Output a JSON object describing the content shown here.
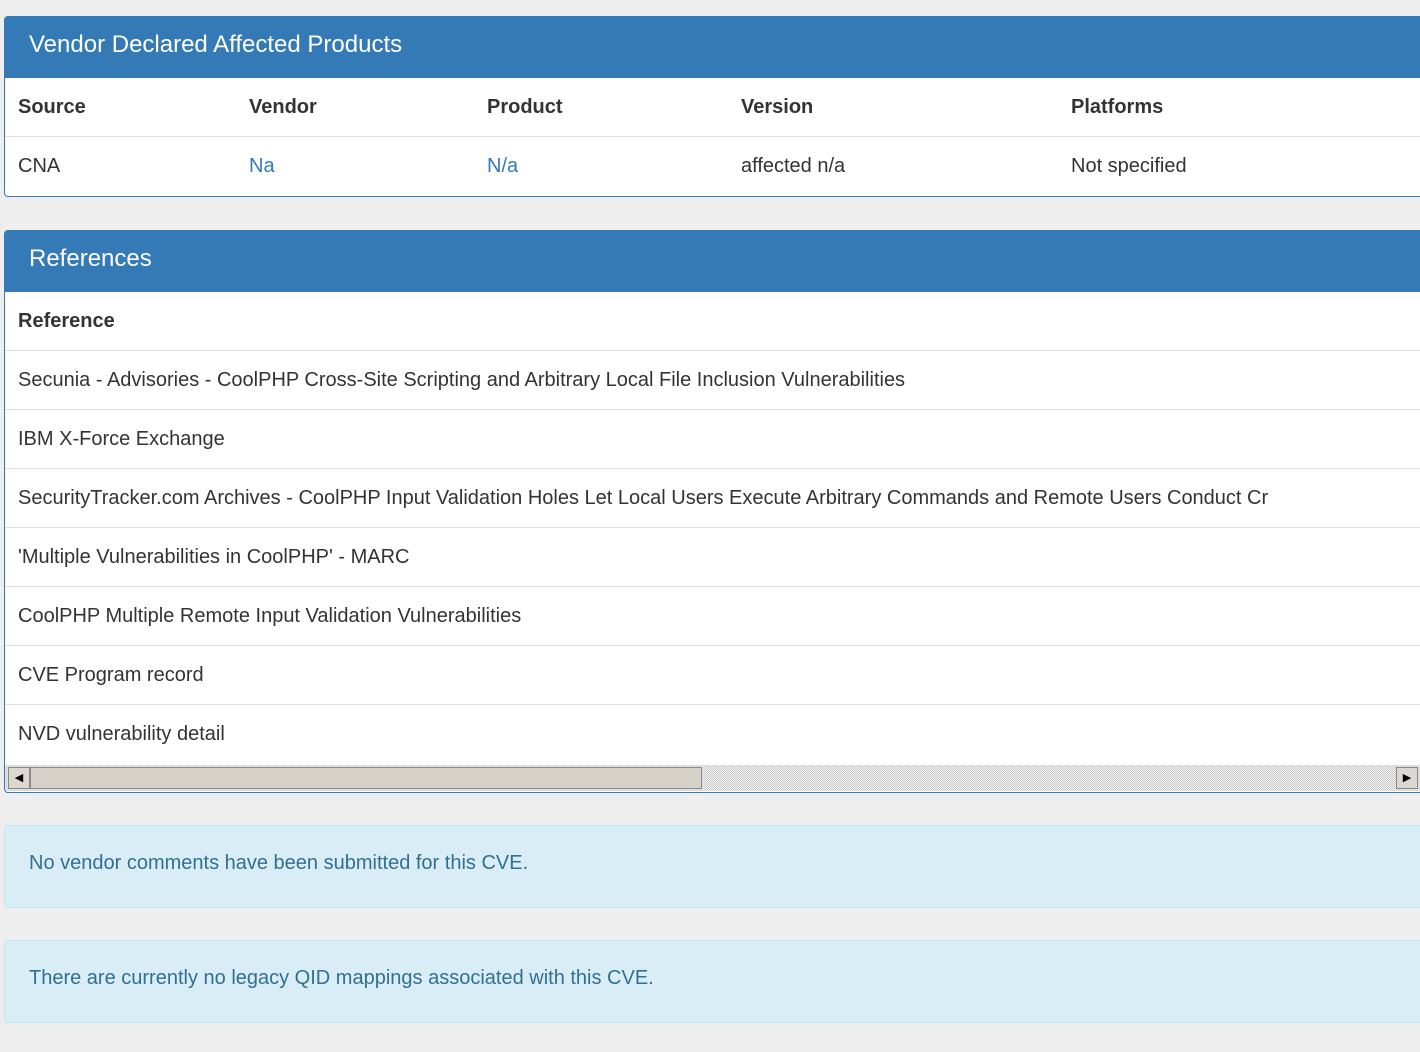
{
  "affected_panel": {
    "title": "Vendor Declared Affected Products",
    "headers": {
      "source": "Source",
      "vendor": "Vendor",
      "product": "Product",
      "version": "Version",
      "platforms": "Platforms"
    },
    "rows": [
      {
        "source": "CNA",
        "vendor": "Na",
        "product": "N/a",
        "version": "affected n/a",
        "platforms": "Not specified"
      }
    ]
  },
  "references_panel": {
    "title": "References",
    "header": "Reference",
    "items": [
      "Secunia - Advisories - CoolPHP Cross-Site Scripting and Arbitrary Local File Inclusion Vulnerabilities",
      "IBM X-Force Exchange",
      "SecurityTracker.com Archives - CoolPHP Input Validation Holes Let Local Users Execute Arbitrary Commands and Remote Users Conduct Cr",
      "'Multiple Vulnerabilities in CoolPHP' - MARC",
      "CoolPHP Multiple Remote Input Validation Vulnerabilities",
      "CVE Program record",
      "NVD vulnerability detail"
    ],
    "scrollbar": {
      "left_arrow": "◀",
      "right_arrow": "▶"
    }
  },
  "alerts": {
    "vendor_comments": "No vendor comments have been submitted for this CVE.",
    "qid_mappings": "There are currently no legacy QID mappings associated with this CVE."
  },
  "colors": {
    "panel_primary": "#337ab7",
    "link": "#337ab7",
    "info_bg": "#d9edf7",
    "info_text": "#31708f",
    "page_bg": "#eeeeee"
  }
}
